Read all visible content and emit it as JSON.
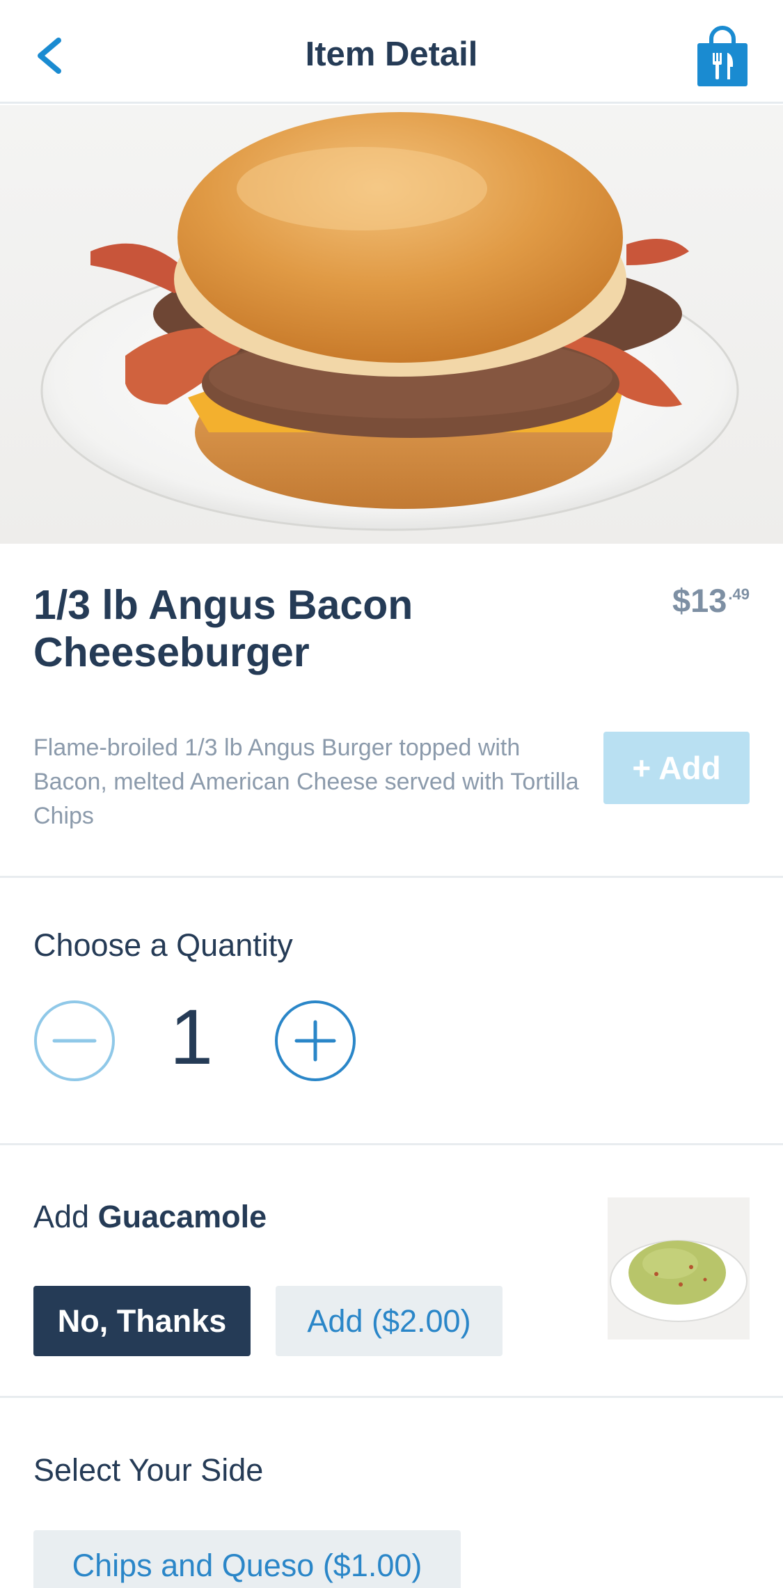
{
  "header": {
    "title": "Item Detail",
    "back_icon": "chevron-left-icon",
    "bag_icon": "shopping-bag-utensils-icon",
    "accent_color": "#1a8bd1"
  },
  "item": {
    "name": "1/3 lb Angus Bacon Cheeseburger",
    "price_main": "$13",
    "price_cents": ".49",
    "description": "Flame-broiled 1/3 lb Angus Burger topped with Bacon, melted American Cheese served with Tortilla Chips",
    "add_label": "+ Add"
  },
  "quantity": {
    "heading": "Choose a Quantity",
    "value": "1",
    "minus_icon": "minus-circle-icon",
    "plus_icon": "plus-circle-icon"
  },
  "guacamole": {
    "heading_prefix": "Add",
    "heading_bold": "Guacamole",
    "options": [
      {
        "label": "No, Thanks",
        "selected": true
      },
      {
        "label": "Add ($2.00)",
        "selected": false
      }
    ]
  },
  "side": {
    "heading": "Select Your Side",
    "options": [
      {
        "label": "Chips and Queso ($1.00)",
        "selected": false
      }
    ]
  }
}
